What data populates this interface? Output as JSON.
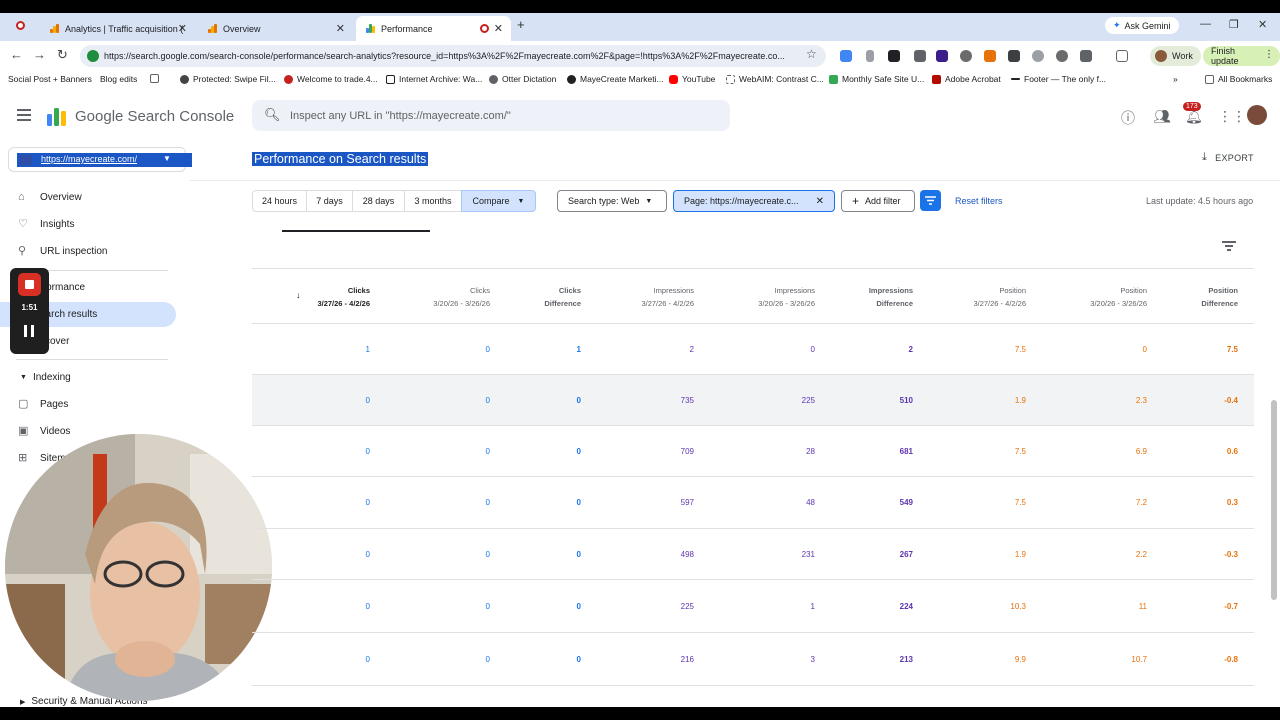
{
  "browser": {
    "tabs": [
      {
        "label": "Analytics | Traffic acquisition (Ed"
      },
      {
        "label": "Overview"
      },
      {
        "label": "Performance"
      }
    ],
    "gemini_label": "Ask Gemini",
    "url": "https://search.google.com/search-console/performance/search-analytics?resource_id=https%3A%2F%2Fmayecreate.com%2F&page=!https%3A%2F%2Fmayecreate.co...",
    "work_label": "Work",
    "finish_update_label": "Finish update",
    "bookmarks": [
      "Social Post + Banners",
      "Blog edits",
      "Protected: Swipe Fil...",
      "Welcome to trade.4...",
      "Internet Archive: Wa...",
      "Otter Dictation",
      "MayeCreate Marketi...",
      "YouTube",
      "WebAIM: Contrast C...",
      "Monthly Safe Site U...",
      "Adobe Acrobat",
      "Footer — The only f...",
      "All Bookmarks"
    ]
  },
  "gsc": {
    "brand": "Google Search Console",
    "search_placeholder": "Inspect any URL in \"https://mayecreate.com/\"",
    "notifications_count": "173",
    "property": "https://mayecreate.com/",
    "page_title": "Performance on Search results",
    "export_label": "EXPORT",
    "nav": {
      "overview": "Overview",
      "insights": "Insights",
      "url_inspection": "URL inspection",
      "performance_section": "rformance",
      "search_results": "earch results",
      "discover": "scover",
      "indexing": "Indexing",
      "pages": "Pages",
      "videos": "Videos",
      "sitemaps": "Sitem",
      "security": "Security & Manual Actions"
    },
    "recorder_time": "1:51",
    "date_ranges": [
      "24 hours",
      "7 days",
      "28 days",
      "3 months"
    ],
    "compare_label": "Compare",
    "search_type_label": "Search type: Web",
    "page_filter_label": "Page: https://mayecreate.c...",
    "add_filter_label": "Add filter",
    "reset_filters_label": "Reset filters",
    "last_update": "Last update: 4.5 hours ago",
    "colors": {
      "clicks": "#1a73e8",
      "impressions": "#5e35b1",
      "position": "#e8710a",
      "accent": "#1a73e8"
    }
  },
  "table": {
    "headers": [
      {
        "metric": "Clicks",
        "date": "3/27/26 - 4/2/26"
      },
      {
        "metric": "Clicks",
        "date": "3/20/26 - 3/26/26"
      },
      {
        "metric": "Clicks",
        "date": "Difference"
      },
      {
        "metric": "Impressions",
        "date": "3/27/26 - 4/2/26"
      },
      {
        "metric": "Impressions",
        "date": "3/20/26 - 3/26/26"
      },
      {
        "metric": "Impressions",
        "date": "Difference"
      },
      {
        "metric": "Position",
        "date": "3/27/26 - 4/2/26"
      },
      {
        "metric": "Position",
        "date": "3/20/26 - 3/26/26"
      },
      {
        "metric": "Position",
        "date": "Difference"
      }
    ],
    "rows": [
      [
        "1",
        "0",
        "1",
        "2",
        "0",
        "2",
        "7.5",
        "0",
        "7.5"
      ],
      [
        "0",
        "0",
        "0",
        "735",
        "225",
        "510",
        "1.9",
        "2.3",
        "-0.4"
      ],
      [
        "0",
        "0",
        "0",
        "709",
        "28",
        "681",
        "7.5",
        "6.9",
        "0.6"
      ],
      [
        "0",
        "0",
        "0",
        "597",
        "48",
        "549",
        "7.5",
        "7.2",
        "0.3"
      ],
      [
        "0",
        "0",
        "0",
        "498",
        "231",
        "267",
        "1.9",
        "2.2",
        "-0.3"
      ],
      [
        "0",
        "0",
        "0",
        "225",
        "1",
        "224",
        "10.3",
        "11",
        "-0.7"
      ],
      [
        "0",
        "0",
        "0",
        "216",
        "3",
        "213",
        "9.9",
        "10.7",
        "-0.8"
      ]
    ]
  }
}
